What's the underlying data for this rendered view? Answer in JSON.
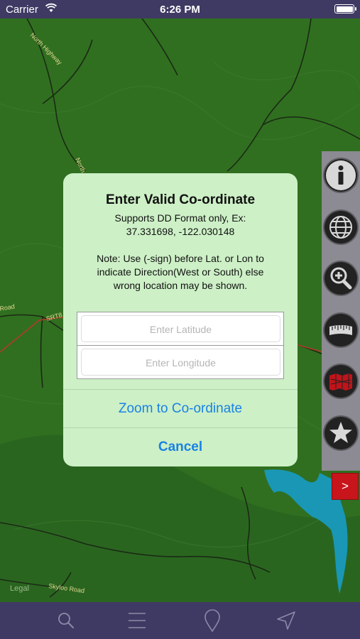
{
  "status_bar": {
    "carrier": "Carrier",
    "time": "6:26 PM"
  },
  "map": {
    "legal": "Legal",
    "road_labels": [
      "North Highway",
      "North Hig",
      "Road",
      "SRT8",
      "Skyloo Road"
    ],
    "colors": {
      "land": "#2d6a1e",
      "water": "#1997b5",
      "roads": "#1a2a14",
      "highway": "#b13a2a"
    }
  },
  "dialog": {
    "title": "Enter Valid Co-ordinate",
    "msg_line1": "Supports DD Format only, Ex:",
    "msg_line2": "37.331698, -122.030148",
    "msg_line3": "Note: Use (-sign) before Lat. or Lon to",
    "msg_line4": "indicate Direction(West or South) else",
    "msg_line5": "wrong location may be shown.",
    "latitude_placeholder": "Enter Latitude",
    "longitude_placeholder": "Enter Longitude",
    "zoom_button": "Zoom to Co-ordinate",
    "cancel_button": "Cancel",
    "colors": {
      "background": "#cdf0c6",
      "button_text": "#1a82e6"
    }
  },
  "toolbar": {
    "icons": [
      "info-icon",
      "globe-icon",
      "zoom-in-icon",
      "ruler-icon",
      "map-layers-icon",
      "star-icon"
    ],
    "expand_label": ">"
  },
  "tab_bar": {
    "icons": [
      "search-icon",
      "menu-icon",
      "pin-icon",
      "location-arrow-icon"
    ]
  }
}
